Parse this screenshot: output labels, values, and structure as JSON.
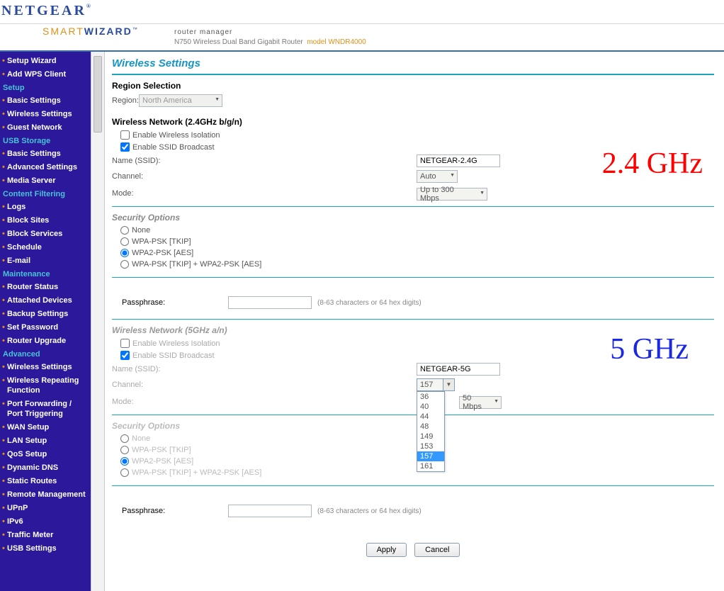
{
  "header": {
    "brand": "NETGEAR",
    "sw_left": "SMART",
    "sw_right": "WIZARD",
    "rm": "router manager",
    "sub": "N750 Wireless Dual Band Gigabit Router",
    "model": "model WNDR4000"
  },
  "sidebar": {
    "top": [
      "Setup Wizard",
      "Add WPS Client"
    ],
    "groups": [
      {
        "heading": "Setup",
        "items": [
          "Basic Settings",
          "Wireless Settings",
          "Guest Network"
        ]
      },
      {
        "heading": "USB Storage",
        "items": [
          "Basic Settings",
          "Advanced Settings",
          "Media Server"
        ]
      },
      {
        "heading": "Content Filtering",
        "items": [
          "Logs",
          "Block Sites",
          "Block Services",
          "Schedule",
          "E-mail"
        ]
      },
      {
        "heading": "Maintenance",
        "items": [
          "Router Status",
          "Attached Devices",
          "Backup Settings",
          "Set Password",
          "Router Upgrade"
        ]
      },
      {
        "heading": "Advanced",
        "items": [
          "Wireless Settings",
          "Wireless Repeating Function",
          "Port Forwarding / Port Triggering",
          "WAN Setup",
          "LAN Setup",
          "QoS Setup",
          "Dynamic DNS",
          "Static Routes",
          "Remote Management",
          "UPnP",
          "IPv6",
          "Traffic Meter",
          "USB Settings"
        ]
      }
    ]
  },
  "page": {
    "title": "Wireless Settings",
    "region": {
      "label": "Region Selection",
      "fieldlabel": "Region:",
      "value": "North America"
    },
    "band24": {
      "heading": "Wireless Network (2.4GHz b/g/n)",
      "iso": "Enable Wireless Isolation",
      "iso_checked": false,
      "bcast": "Enable SSID Broadcast",
      "bcast_checked": true,
      "ssid_label": "Name (SSID):",
      "ssid": "NETGEAR-2.4G",
      "chan_label": "Channel:",
      "chan": "Auto",
      "mode_label": "Mode:",
      "mode": "Up to 300 Mbps",
      "annot": "2.4 GHz",
      "sec_heading": "Security Options",
      "sec": [
        "None",
        "WPA-PSK [TKIP]",
        "WPA2-PSK [AES]",
        "WPA-PSK [TKIP] + WPA2-PSK [AES]"
      ],
      "sec_sel": 2,
      "pass_label": "Passphrase:",
      "pass_hint": "(8-63 characters or 64 hex digits)"
    },
    "band5": {
      "heading": "Wireless Network (5GHz a/n)",
      "iso": "Enable Wireless Isolation",
      "iso_checked": false,
      "bcast": "Enable SSID Broadcast",
      "bcast_checked": true,
      "ssid_label": "Name (SSID):",
      "ssid": "NETGEAR-5G",
      "chan_label": "Channel:",
      "chan": "157",
      "chan_options": [
        "36",
        "40",
        "44",
        "48",
        "149",
        "153",
        "157",
        "161"
      ],
      "chan_sel": "157",
      "mode_label": "Mode:",
      "mode": "50 Mbps",
      "annot": "5 GHz",
      "sec_heading": "Security Options",
      "sec": [
        "None",
        "WPA-PSK [TKIP]",
        "WPA2-PSK [AES]",
        "WPA-PSK [TKIP] + WPA2-PSK [AES]"
      ],
      "sec_sel": 2,
      "pass_label": "Passphrase:",
      "pass_hint": "(8-63 characters or 64 hex digits)"
    },
    "buttons": {
      "apply": "Apply",
      "cancel": "Cancel"
    }
  }
}
